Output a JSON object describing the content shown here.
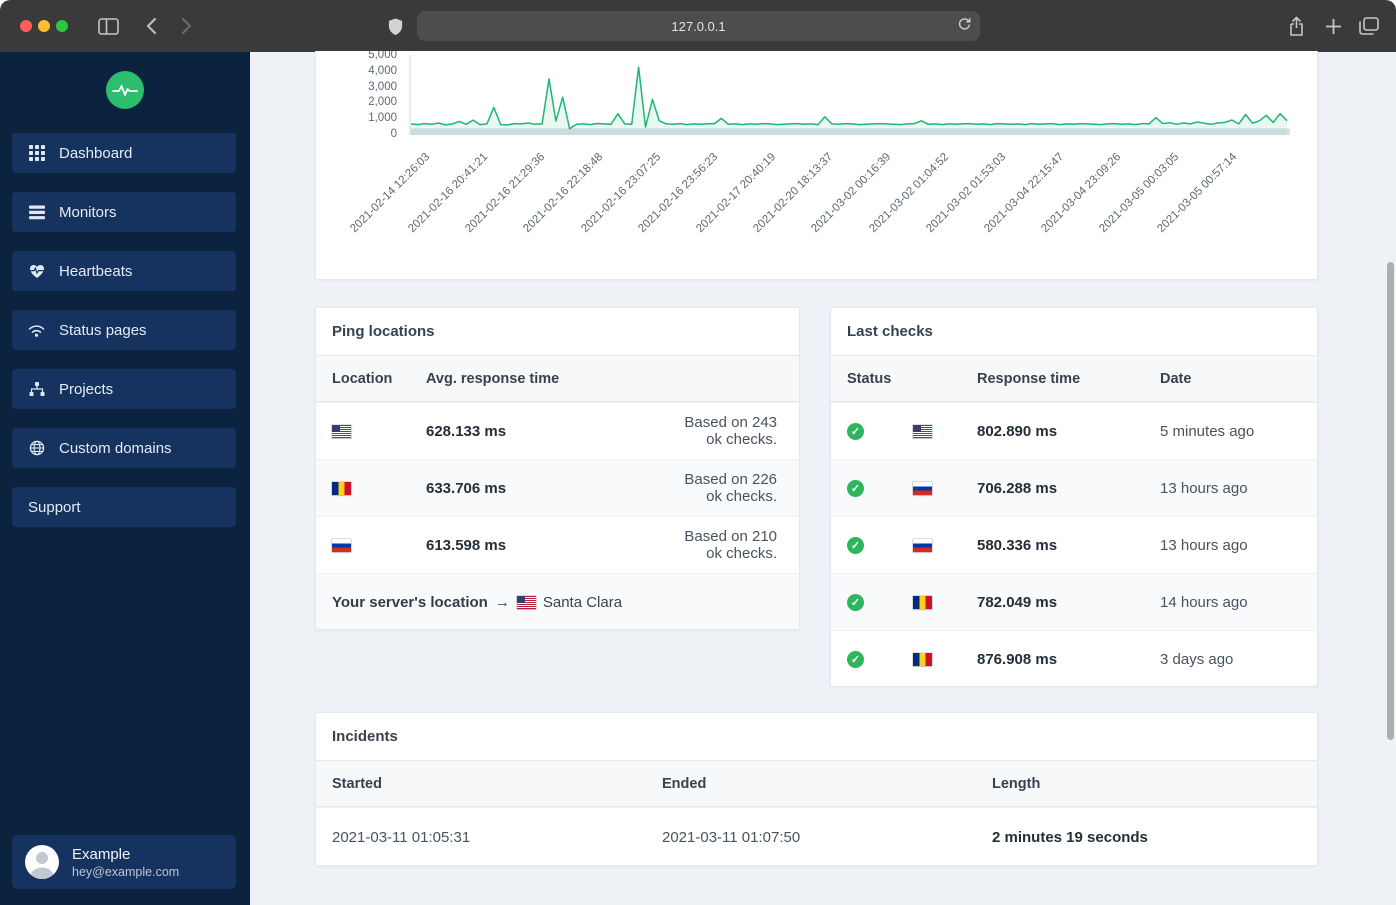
{
  "browser": {
    "url": "127.0.0.1",
    "icons": [
      "sidebar-toggle-icon",
      "back-icon",
      "forward-icon",
      "privacy-shield-icon",
      "reload-icon",
      "share-icon",
      "new-tab-icon",
      "tabs-overview-icon"
    ]
  },
  "sidebar": {
    "logo_icon": "pulse-icon",
    "items": [
      {
        "label": "Dashboard",
        "icon": "grid-icon"
      },
      {
        "label": "Monitors",
        "icon": "list-icon"
      },
      {
        "label": "Heartbeats",
        "icon": "heart-pulse-icon"
      },
      {
        "label": "Status pages",
        "icon": "wifi-icon"
      },
      {
        "label": "Projects",
        "icon": "sitemap-icon"
      },
      {
        "label": "Custom domains",
        "icon": "globe-icon"
      },
      {
        "label": "Support",
        "icon": ""
      }
    ],
    "user": {
      "name": "Example",
      "email": "hey@example.com",
      "icon": "avatar-person-icon"
    }
  },
  "chart_data": {
    "type": "line",
    "title": "",
    "xlabel": "",
    "ylabel": "",
    "ylim": [
      0,
      5000
    ],
    "grid": false,
    "legend": false,
    "line_color": "#1fb572",
    "yticks": [
      "0",
      "1,000",
      "2,000",
      "3,000",
      "4,000",
      "5,000"
    ],
    "xticklabels": [
      "2021-02-14 12:26:03",
      "2021-02-16 20:41:21",
      "2021-02-16 21:29:36",
      "2021-02-16 22:18:48",
      "2021-02-16 23:07:25",
      "2021-02-16 23:56:23",
      "2021-02-17 20:40:19",
      "2021-02-20 18:13:37",
      "2021-03-02 00:16:39",
      "2021-03-02 01:04:52",
      "2021-03-02 01:53:03",
      "2021-03-04 22:15:47",
      "2021-03-04 23:09:26",
      "2021-03-05 00:03:05",
      "2021-03-05 00:57:14"
    ],
    "series": [
      {
        "values": [
          700,
          660,
          720,
          680,
          760,
          640,
          700,
          860,
          680,
          940,
          660,
          700,
          1750,
          660,
          640,
          720,
          700,
          760,
          680,
          700,
          3550,
          880,
          2400,
          400,
          680,
          700,
          660,
          730,
          700,
          680,
          1350,
          700,
          680,
          4300,
          500,
          2250,
          900,
          700,
          680,
          720,
          660,
          700,
          680,
          700,
          720,
          1050,
          680,
          700,
          660,
          700,
          680,
          720,
          700,
          660,
          680,
          700,
          720,
          680,
          700,
          660,
          1150,
          700,
          680,
          720,
          700,
          660,
          680,
          700,
          720,
          700,
          680,
          660,
          700,
          720,
          900,
          680,
          700,
          660,
          700,
          680,
          700,
          720,
          680,
          700,
          660,
          720,
          700,
          680,
          700,
          660,
          720,
          680,
          700,
          720,
          660,
          700,
          680,
          720,
          700,
          680,
          660,
          700,
          720,
          680,
          700,
          660,
          720,
          700,
          1100,
          720,
          780,
          680,
          760,
          700,
          820,
          740,
          680,
          760,
          800,
          950,
          700,
          1300,
          750,
          900,
          1250,
          800,
          1350,
          900
        ]
      }
    ]
  },
  "ping_locations": {
    "title": "Ping locations",
    "columns": [
      "Location",
      "Avg. response time"
    ],
    "rows": [
      {
        "flag": "us",
        "avg": "628.133 ms",
        "note": "Based on 243 ok checks."
      },
      {
        "flag": "ro",
        "avg": "633.706 ms",
        "note": "Based on 226 ok checks."
      },
      {
        "flag": "ru",
        "avg": "613.598 ms",
        "note": "Based on 210 ok checks."
      }
    ],
    "footer": {
      "label": "Your server's location",
      "arrow": "→",
      "flag": "us",
      "city": "Santa Clara"
    }
  },
  "last_checks": {
    "title": "Last checks",
    "columns": [
      "Status",
      "Response time",
      "Date"
    ],
    "status_icon": "check-circle-icon",
    "status_check": "✓",
    "rows": [
      {
        "status": "ok",
        "flag": "us",
        "time": "802.890 ms",
        "date": "5 minutes ago"
      },
      {
        "status": "ok",
        "flag": "ru",
        "time": "706.288 ms",
        "date": "13 hours ago"
      },
      {
        "status": "ok",
        "flag": "ru",
        "time": "580.336 ms",
        "date": "13 hours ago"
      },
      {
        "status": "ok",
        "flag": "ro",
        "time": "782.049 ms",
        "date": "14 hours ago"
      },
      {
        "status": "ok",
        "flag": "ro",
        "time": "876.908 ms",
        "date": "3 days ago"
      }
    ]
  },
  "incidents": {
    "title": "Incidents",
    "columns": [
      "Started",
      "Ended",
      "Length"
    ],
    "rows": [
      {
        "started": "2021-03-11 01:05:31",
        "ended": "2021-03-11 01:07:50",
        "length": "2 minutes 19 seconds"
      }
    ]
  }
}
